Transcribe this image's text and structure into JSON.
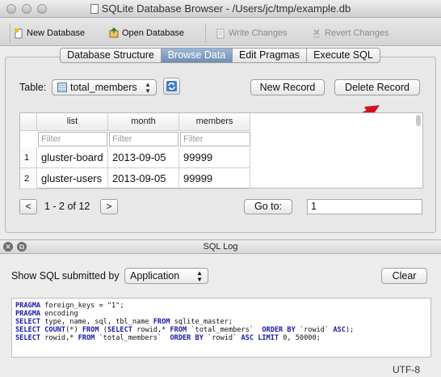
{
  "window": {
    "title": "SQLite Database Browser - /Users/jc/tmp/example.db"
  },
  "toolbar": {
    "new_database": "New Database",
    "open_database": "Open Database",
    "write_changes": "Write Changes",
    "revert_changes": "Revert Changes"
  },
  "tabs": [
    {
      "label": "Database Structure",
      "active": false
    },
    {
      "label": "Browse Data",
      "active": true
    },
    {
      "label": "Edit Pragmas",
      "active": false
    },
    {
      "label": "Execute SQL",
      "active": false
    }
  ],
  "browse": {
    "table_label": "Table:",
    "table_value": "total_members",
    "new_record": "New Record",
    "delete_record": "Delete Record",
    "columns": [
      "list",
      "month",
      "members"
    ],
    "filter_placeholder": "Filter",
    "rows": [
      {
        "num": "1",
        "cells": [
          "gluster-board",
          "2013-09-05",
          "99999"
        ]
      },
      {
        "num": "2",
        "cells": [
          "gluster-users",
          "2013-09-05",
          "99999"
        ]
      }
    ],
    "prev": "<",
    "next": ">",
    "pager_text": "1 - 2 of 12",
    "goto_label": "Go to:",
    "goto_value": "1"
  },
  "sqllog": {
    "title": "SQL Log",
    "show_label": "Show SQL submitted by",
    "source_value": "Application",
    "clear": "Clear",
    "lines": [
      "PRAGMA foreign_keys = \"1\";",
      "PRAGMA encoding",
      "SELECT type, name, sql, tbl_name FROM sqlite_master;",
      "SELECT COUNT(*) FROM (SELECT rowid,* FROM `total_members`  ORDER BY `rowid` ASC);",
      "SELECT rowid,* FROM `total_members`  ORDER BY `rowid` ASC LIMIT 0, 50000;"
    ]
  },
  "status": {
    "encoding": "UTF-8"
  },
  "colors": {
    "annotation_arrow": "#d4121b",
    "active_tab": "#7f9fc4",
    "sql_keyword": "#1a1aa6"
  }
}
